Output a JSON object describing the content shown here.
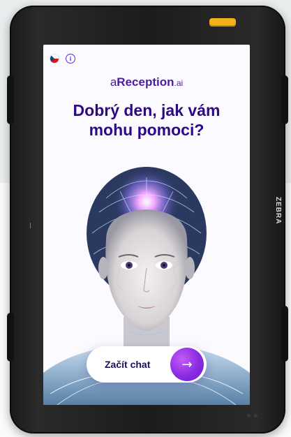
{
  "device": {
    "brand": "ZEBRA",
    "accent_color": "#f3b21a"
  },
  "topbar": {
    "flag_icon": "czech-flag-icon",
    "info_icon": "info-icon",
    "info_glyph": "i"
  },
  "logo": {
    "prefix": "a",
    "name": "Reception",
    "suffix": ".ai"
  },
  "headline": {
    "line1": "Dobrý den, jak vám",
    "line2": "mohu pomoci?"
  },
  "cta": {
    "label": "Začít chat",
    "arrow": "→"
  },
  "colors": {
    "primary": "#5b2bd8",
    "heading": "#2c0a86",
    "button_gradient_start": "#c35cf6",
    "button_gradient_end": "#6b1fd0"
  }
}
